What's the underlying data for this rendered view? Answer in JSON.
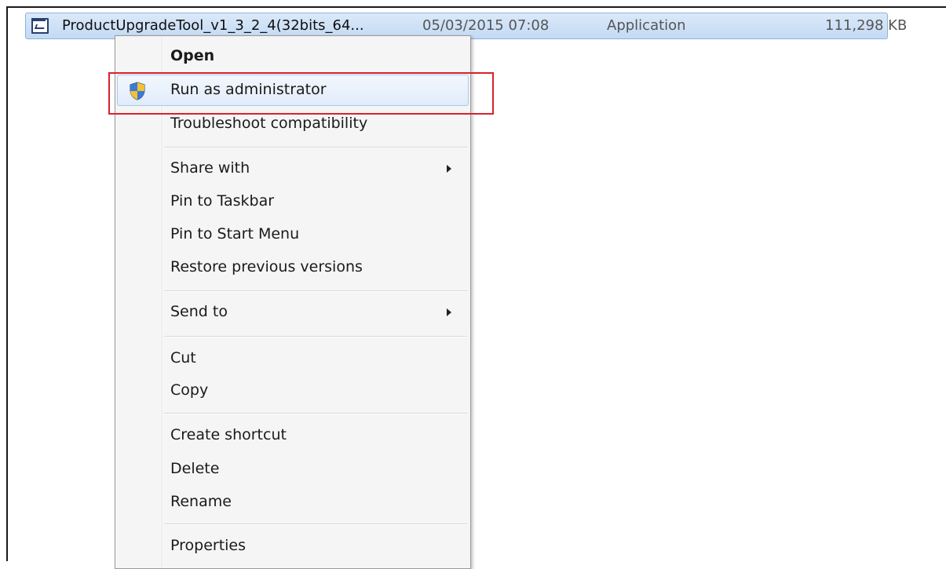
{
  "file": {
    "name": "ProductUpgradeTool_v1_3_2_4(32bits_64...",
    "date_modified": "05/03/2015 07:08",
    "type": "Application",
    "size": "111,298 KB",
    "icon": "application-window-icon"
  },
  "context_menu": {
    "items": [
      {
        "label": "Open",
        "bold": true
      },
      {
        "label": "Run as administrator",
        "icon": "uac-shield-icon",
        "highlighted": true
      },
      {
        "label": "Troubleshoot compatibility"
      },
      {
        "label": "Share with",
        "submenu": true
      },
      {
        "label": "Pin to Taskbar"
      },
      {
        "label": "Pin to Start Menu"
      },
      {
        "label": "Restore previous versions"
      },
      {
        "label": "Send to",
        "submenu": true
      },
      {
        "label": "Cut"
      },
      {
        "label": "Copy"
      },
      {
        "label": "Create shortcut"
      },
      {
        "label": "Delete"
      },
      {
        "label": "Rename"
      },
      {
        "label": "Properties"
      }
    ]
  },
  "colors": {
    "selection_bg": "#c3daf4",
    "highlight_box": "#d9212e",
    "menu_bg": "#f5f5f5"
  }
}
